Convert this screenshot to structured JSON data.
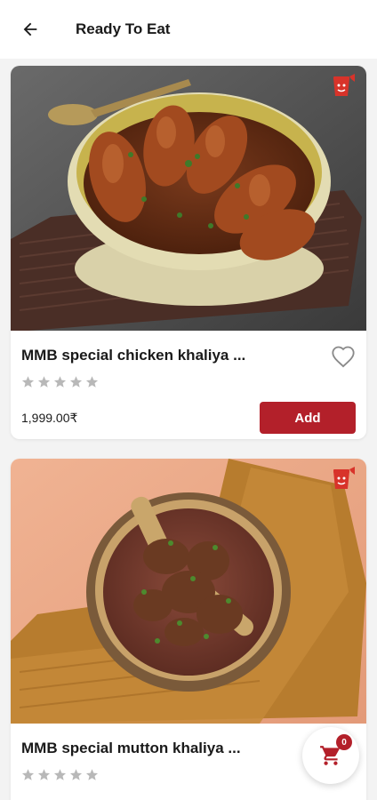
{
  "appbar": {
    "title": "Ready To Eat",
    "back_icon": "arrow-left-icon"
  },
  "products": [
    {
      "name": "MMB special chicken khaliya ...",
      "rating": 0,
      "rating_max": 5,
      "price": "1,999.00₹",
      "add_label": "Add",
      "image_icon": "chicken-curry-photo",
      "badge_icon": "brand-logo-icon",
      "favorite_icon": "heart-outline-icon"
    },
    {
      "name": "MMB special mutton khaliya ...",
      "rating": 0,
      "rating_max": 5,
      "image_icon": "mutton-curry-photo",
      "badge_icon": "brand-logo-icon"
    }
  ],
  "cart": {
    "count": "0",
    "icon": "cart-icon"
  },
  "colors": {
    "accent": "#b3202a",
    "background": "#f3f3f3",
    "star_inactive": "#b8b8b8"
  }
}
